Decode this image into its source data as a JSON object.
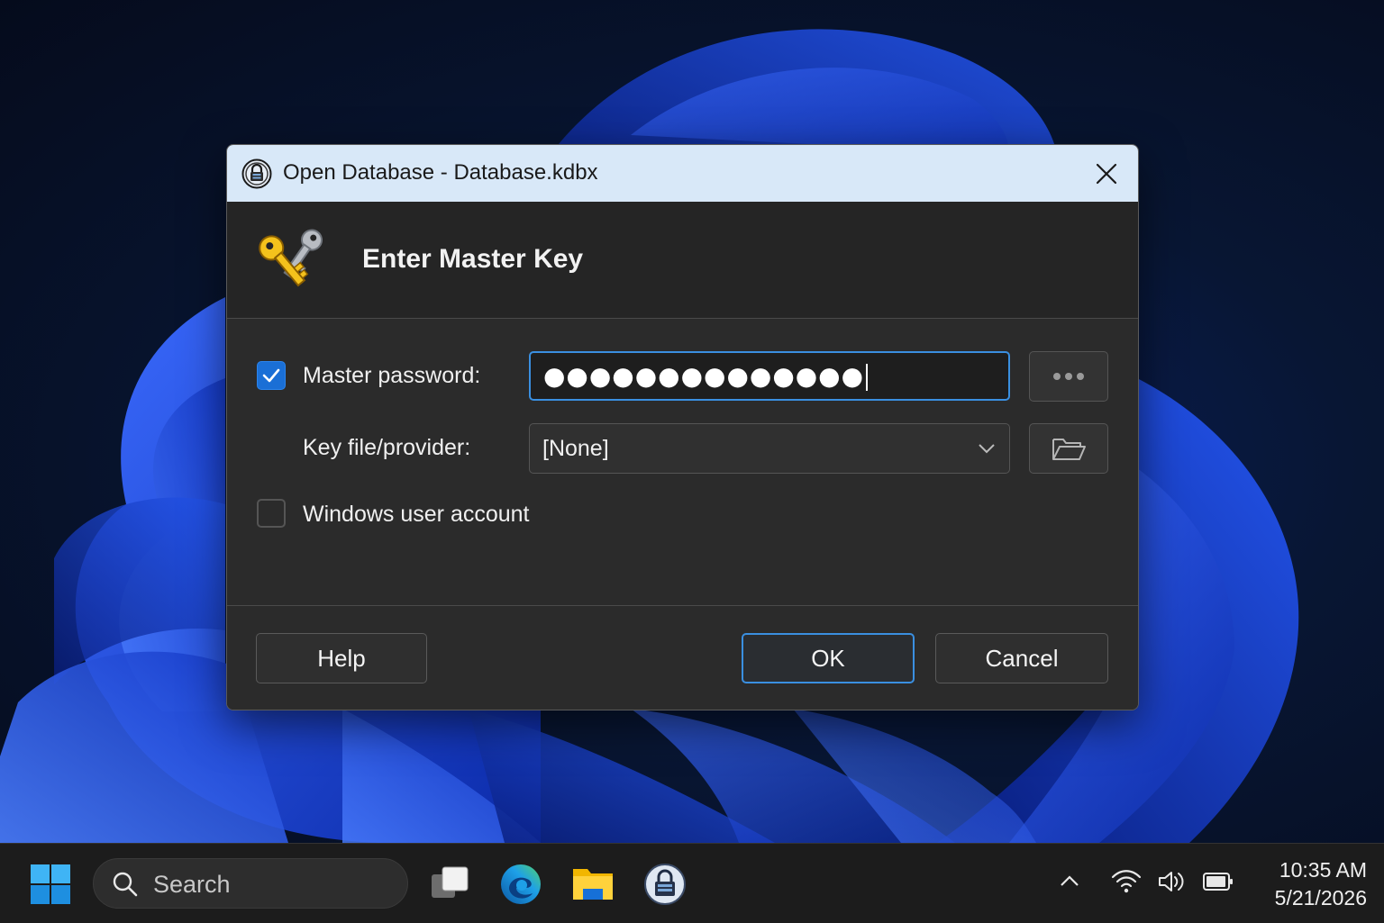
{
  "dialog": {
    "title": "Open Database - Database.kdbx",
    "header_title": "Enter Master Key",
    "master_password": {
      "label": "Master password:",
      "checked": true,
      "masked_value": "●●●●●●●●●●●●●●"
    },
    "key_file": {
      "label": "Key file/provider:",
      "selected": "[None]"
    },
    "windows_account": {
      "label": "Windows user account",
      "checked": false
    },
    "buttons": {
      "help": "Help",
      "ok": "OK",
      "cancel": "Cancel"
    }
  },
  "taskbar": {
    "search_placeholder": "Search",
    "apps": [
      "task-view-icon",
      "edge-icon",
      "file-explorer-icon",
      "keepass-icon"
    ],
    "clock": {
      "time": "10:35 AM",
      "date": "5/21/2026"
    }
  },
  "colors": {
    "accent": "#1a6fd6",
    "titlebar": "#d8e8f8",
    "dialog_bg": "#2b2b2b",
    "taskbar_bg": "#1c1c1c"
  }
}
